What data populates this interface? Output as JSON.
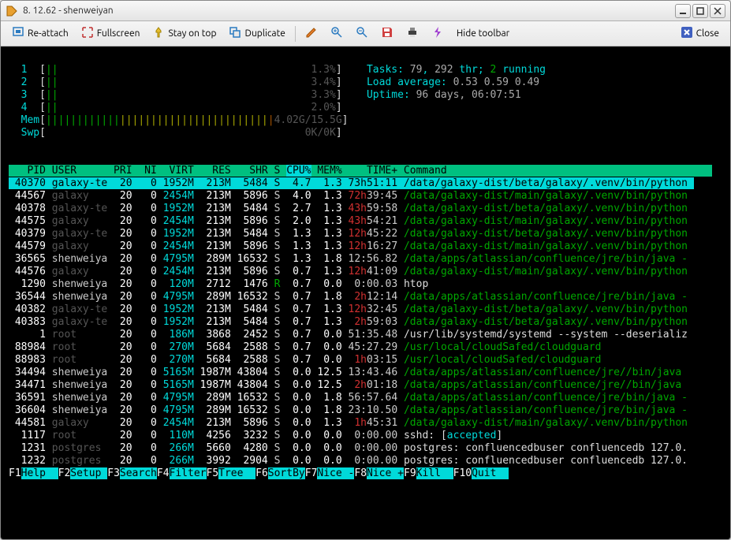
{
  "window": {
    "title": "8. 12.62 - shenweiyan"
  },
  "toolbar": {
    "reattach": "Re-attach",
    "fullscreen": "Fullscreen",
    "stayontop": "Stay on top",
    "duplicate": "Duplicate",
    "hide": "Hide toolbar",
    "close": "Close"
  },
  "cpubars": [
    {
      "n": "1",
      "pct": "1.3%"
    },
    {
      "n": "2",
      "pct": "3.4%"
    },
    {
      "n": "3",
      "pct": "3.3%"
    },
    {
      "n": "4",
      "pct": "2.0%"
    }
  ],
  "mem": {
    "label": "Mem",
    "value": "4.02G/15.5G"
  },
  "swp": {
    "label": "Swp",
    "value": "0K/0K"
  },
  "info": {
    "tasks_label": "Tasks: ",
    "tasks_val": "79",
    "thr_label": ", ",
    "thr_val": "292",
    "thr_suf": " thr; ",
    "running": "2",
    "running_suf": " running",
    "load_label": "Load average: ",
    "load_val": "0.53 0.59 0.49",
    "uptime_label": "Uptime: ",
    "uptime_val": "96 days, 06:07:51"
  },
  "header": {
    "pid": "PID",
    "user": "USER",
    "pri": "PRI",
    "ni": "NI",
    "virt": "VIRT",
    "res": "RES",
    "shr": "SHR",
    "s": "S",
    "cpu": "CPU%",
    "mem": "MEM%",
    "time": "TIME+",
    "cmd": "Command"
  },
  "rows": [
    {
      "sel": true,
      "pid": "40370",
      "user": "galaxy-te",
      "dimuser": false,
      "pri": "20",
      "ni": "0",
      "virt": "1952M",
      "res": "213M",
      "shr": "5484",
      "s": "S",
      "cpu": "4.7",
      "mem": "1.3",
      "time_red": "73h",
      "time_rest": "51:11",
      "cmd": "/data/galaxy-dist/beta/galaxy/.venv/bin/python"
    },
    {
      "pid": "44567",
      "user": "galaxy",
      "dimuser": true,
      "pri": "20",
      "ni": "0",
      "virt": "2454M",
      "res": "213M",
      "shr": "5896",
      "s": "S",
      "cpu": "4.0",
      "mem": "1.3",
      "time_red": "72h",
      "time_rest": "39:45",
      "cmd": "/data/galaxy-dist/main/galaxy/.venv/bin/python",
      "cmdclr": "grn"
    },
    {
      "pid": "40378",
      "user": "galaxy-te",
      "dimuser": true,
      "pri": "20",
      "ni": "0",
      "virt": "1952M",
      "res": "213M",
      "shr": "5484",
      "s": "S",
      "cpu": "2.7",
      "mem": "1.3",
      "time_red": "43h",
      "time_rest": "59:58",
      "cmd": "/data/galaxy-dist/beta/galaxy/.venv/bin/python",
      "cmdclr": "grn"
    },
    {
      "pid": "44575",
      "user": "galaxy",
      "dimuser": true,
      "pri": "20",
      "ni": "0",
      "virt": "2454M",
      "res": "213M",
      "shr": "5896",
      "s": "S",
      "cpu": "2.0",
      "mem": "1.3",
      "time_red": "43h",
      "time_rest": "54:21",
      "cmd": "/data/galaxy-dist/main/galaxy/.venv/bin/python",
      "cmdclr": "grn"
    },
    {
      "pid": "40379",
      "user": "galaxy-te",
      "dimuser": true,
      "pri": "20",
      "ni": "0",
      "virt": "1952M",
      "res": "213M",
      "shr": "5484",
      "s": "S",
      "cpu": "1.3",
      "mem": "1.3",
      "time_red": "12h",
      "time_rest": "45:22",
      "cmd": "/data/galaxy-dist/beta/galaxy/.venv/bin/python",
      "cmdclr": "grn"
    },
    {
      "pid": "44579",
      "user": "galaxy",
      "dimuser": true,
      "pri": "20",
      "ni": "0",
      "virt": "2454M",
      "res": "213M",
      "shr": "5896",
      "s": "S",
      "cpu": "1.3",
      "mem": "1.3",
      "time_red": "12h",
      "time_rest": "16:27",
      "cmd": "/data/galaxy-dist/main/galaxy/.venv/bin/python",
      "cmdclr": "grn"
    },
    {
      "pid": "36565",
      "user": "shenweiya",
      "dimuser": false,
      "pri": "20",
      "ni": "0",
      "virt": "4795M",
      "res": "289M",
      "shr": "16532",
      "s": "S",
      "cpu": "1.3",
      "mem": "1.8",
      "time_red": "",
      "time_rest": "12:56.82",
      "cmd": "/data/apps/atlassian/confluence/jre/bin/java -",
      "cmdclr": "grn"
    },
    {
      "pid": "44576",
      "user": "galaxy",
      "dimuser": true,
      "pri": "20",
      "ni": "0",
      "virt": "2454M",
      "res": "213M",
      "shr": "5896",
      "s": "S",
      "cpu": "0.7",
      "mem": "1.3",
      "time_red": "12h",
      "time_rest": "41:09",
      "cmd": "/data/galaxy-dist/main/galaxy/.venv/bin/python",
      "cmdclr": "grn"
    },
    {
      "pid": "1290",
      "user": "shenweiya",
      "dimuser": false,
      "pri": "20",
      "ni": "0",
      "virt": "120M",
      "res": "2712",
      "shr": "1476",
      "s": "R",
      "sclr": "grn",
      "cpu": "0.7",
      "mem": "0.0",
      "time_red": "",
      "time_rest": "0:00.03",
      "cmd": "htop",
      "cmdclr": "wht"
    },
    {
      "pid": "36544",
      "user": "shenweiya",
      "dimuser": false,
      "pri": "20",
      "ni": "0",
      "virt": "4795M",
      "res": "289M",
      "shr": "16532",
      "s": "S",
      "cpu": "0.7",
      "mem": "1.8",
      "time_red": "2h",
      "time_rest": "12:14",
      "cmd": "/data/apps/atlassian/confluence/jre/bin/java -",
      "cmdclr": "grn"
    },
    {
      "pid": "40382",
      "user": "galaxy-te",
      "dimuser": true,
      "pri": "20",
      "ni": "0",
      "virt": "1952M",
      "res": "213M",
      "shr": "5484",
      "s": "S",
      "cpu": "0.7",
      "mem": "1.3",
      "time_red": "12h",
      "time_rest": "32:45",
      "cmd": "/data/galaxy-dist/beta/galaxy/.venv/bin/python",
      "cmdclr": "grn"
    },
    {
      "pid": "40383",
      "user": "galaxy-te",
      "dimuser": true,
      "pri": "20",
      "ni": "0",
      "virt": "1952M",
      "res": "213M",
      "shr": "5484",
      "s": "S",
      "cpu": "0.7",
      "mem": "1.3",
      "time_red": "2h",
      "time_rest": "59:03",
      "cmd": "/data/galaxy-dist/beta/galaxy/.venv/bin/python",
      "cmdclr": "grn"
    },
    {
      "pid": "1",
      "user": "root",
      "dimuser": true,
      "pri": "20",
      "ni": "0",
      "virt": "186M",
      "res": "3868",
      "shr": "2452",
      "s": "S",
      "cpu": "0.7",
      "mem": "0.0",
      "time_red": "",
      "time_rest": "51:35.48",
      "cmd": "/usr/lib/systemd/systemd --system --deserializ",
      "cmdclr": "wht"
    },
    {
      "pid": "88984",
      "user": "root",
      "dimuser": true,
      "pri": "20",
      "ni": "0",
      "virt": "270M",
      "res": "5684",
      "shr": "2588",
      "s": "S",
      "cpu": "0.7",
      "mem": "0.0",
      "time_red": "",
      "time_rest": "45:27.29",
      "cmd": "/usr/local/cloudSafed/cloudguard",
      "cmdclr": "grn"
    },
    {
      "pid": "88983",
      "user": "root",
      "dimuser": true,
      "pri": "20",
      "ni": "0",
      "virt": "270M",
      "res": "5684",
      "shr": "2588",
      "s": "S",
      "cpu": "0.7",
      "mem": "0.0",
      "time_red": "1h",
      "time_rest": "03:15",
      "cmd": "/usr/local/cloudSafed/cloudguard",
      "cmdclr": "grn"
    },
    {
      "pid": "34494",
      "user": "shenweiya",
      "dimuser": false,
      "pri": "20",
      "ni": "0",
      "virt": "5165M",
      "res": "1987M",
      "shr": "43804",
      "s": "S",
      "cpu": "0.0",
      "mem": "12.5",
      "time_red": "",
      "time_rest": "13:43.46",
      "cmd": "/data/apps/atlassian/confluence/jre//bin/java",
      "cmdclr": "grn"
    },
    {
      "pid": "34471",
      "user": "shenweiya",
      "dimuser": false,
      "pri": "20",
      "ni": "0",
      "virt": "5165M",
      "res": "1987M",
      "shr": "43804",
      "s": "S",
      "cpu": "0.0",
      "mem": "12.5",
      "time_red": "2h",
      "time_rest": "01:18",
      "cmd": "/data/apps/atlassian/confluence/jre//bin/java",
      "cmdclr": "grn"
    },
    {
      "pid": "36591",
      "user": "shenweiya",
      "dimuser": false,
      "pri": "20",
      "ni": "0",
      "virt": "4795M",
      "res": "289M",
      "shr": "16532",
      "s": "S",
      "cpu": "0.0",
      "mem": "1.8",
      "time_red": "",
      "time_rest": "56:57.64",
      "cmd": "/data/apps/atlassian/confluence/jre/bin/java -",
      "cmdclr": "grn"
    },
    {
      "pid": "36604",
      "user": "shenweiya",
      "dimuser": false,
      "pri": "20",
      "ni": "0",
      "virt": "4795M",
      "res": "289M",
      "shr": "16532",
      "s": "S",
      "cpu": "0.0",
      "mem": "1.8",
      "time_red": "",
      "time_rest": "23:10.50",
      "cmd": "/data/apps/atlassian/confluence/jre/bin/java -",
      "cmdclr": "grn"
    },
    {
      "pid": "44581",
      "user": "galaxy",
      "dimuser": true,
      "pri": "20",
      "ni": "0",
      "virt": "2454M",
      "res": "213M",
      "shr": "5896",
      "s": "S",
      "cpu": "0.0",
      "mem": "1.3",
      "time_red": "1h",
      "time_rest": "45:31",
      "cmd": "/data/galaxy-dist/main/galaxy/.venv/bin/python",
      "cmdclr": "grn"
    },
    {
      "pid": "1117",
      "user": "root",
      "dimuser": true,
      "pri": "20",
      "ni": "0",
      "virt": "110M",
      "res": "4256",
      "shr": "3232",
      "s": "S",
      "cpu": "0.0",
      "mem": "0.0",
      "time_red": "",
      "time_rest": "0:00.00",
      "cmd_sshd": true
    },
    {
      "pid": "1231",
      "user": "postgres",
      "dimuser": true,
      "pri": "20",
      "ni": "0",
      "virt": "266M",
      "res": "5660",
      "shr": "4280",
      "s": "S",
      "cpu": "0.0",
      "mem": "0.0",
      "time_red": "",
      "time_rest": "0:00.00",
      "cmd": "postgres: confluencedbuser confluencedb 127.0.",
      "cmdclr": "wht"
    },
    {
      "pid": "1232",
      "user": "postgres",
      "dimuser": true,
      "pri": "20",
      "ni": "0",
      "virt": "266M",
      "res": "3992",
      "shr": "2904",
      "s": "S",
      "cpu": "0.0",
      "mem": "0.0",
      "time_red": "",
      "time_rest": "0:00.00",
      "cmd": "postgres: confluencedbuser confluencedb 127.0.",
      "cmdclr": "wht"
    }
  ],
  "sshd": {
    "prefix": "sshd: [",
    "accepted": "accepted",
    "suffix": "]"
  },
  "fkeys": [
    {
      "k": "F1",
      "l": "Help  "
    },
    {
      "k": "F2",
      "l": "Setup "
    },
    {
      "k": "F3",
      "l": "Search"
    },
    {
      "k": "F4",
      "l": "Filter"
    },
    {
      "k": "F5",
      "l": "Tree  "
    },
    {
      "k": "F6",
      "l": "SortBy"
    },
    {
      "k": "F7",
      "l": "Nice -"
    },
    {
      "k": "F8",
      "l": "Nice +"
    },
    {
      "k": "F9",
      "l": "Kill  "
    },
    {
      "k": "F10",
      "l": "Quit  "
    }
  ]
}
